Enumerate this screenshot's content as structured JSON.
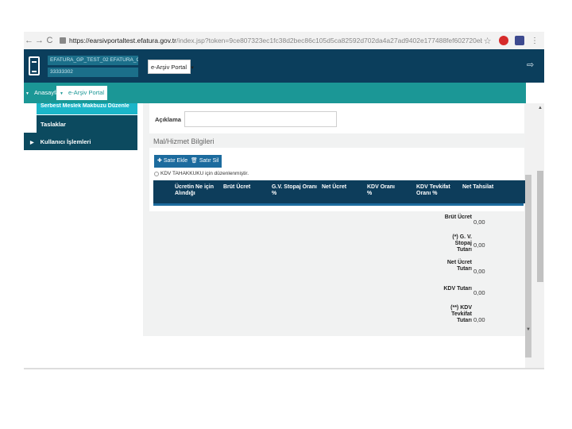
{
  "browser": {
    "url_host": "https://earsivportaltest.efatura.gov.tr",
    "url_rest": "/index.jsp?token=9ce807323ec1fc38d2bec86c105d5ca82592d702da4a27ad9402e177488fef602720ebaa0977e0b85964b32571f6282ee...",
    "back": "←",
    "forward": "→",
    "reload": "C",
    "star": "☆"
  },
  "header": {
    "user_line1": "EFATURA_GP_TEST_02 EFATURA_GP_TEST_02",
    "user_line2": "33333302",
    "portal_select": "e-Arşiv Portal",
    "logout_icon": "⇨"
  },
  "tabs": {
    "home": "Anasayfa",
    "portal": "e-Arşiv Portal"
  },
  "sidebar": {
    "items": [
      {
        "label": "Serbest Meslek Makbuzu Düzenle"
      },
      {
        "label": "Taslaklar"
      },
      {
        "label": "Kullanıcı İşlemleri"
      }
    ]
  },
  "form": {
    "description_label": "Açıklama",
    "description_value": "",
    "section_title": "Mal/Hizmet Bilgileri",
    "add_row": "Satır Ekle",
    "delete_row": "Satır Sil",
    "kdv_check_label": "KDV TAHAKKUKU için düzenlenmiştir."
  },
  "table": {
    "columns": [
      "Ücretin Ne için Alındığı",
      "Brüt Ücret",
      "G.V. Stopaj Oranı %",
      "Net Ücret",
      "KDV Oranı %",
      "KDV Tevkifat Oranı %",
      "Net Tahsilat"
    ]
  },
  "totals": [
    {
      "label": "Brüt Ücret",
      "value": "0,00"
    },
    {
      "label": "(*) G. V. Stopaj Tutarı",
      "value": "0,00"
    },
    {
      "label": "Net Ücret Tutarı",
      "value": "0,00"
    },
    {
      "label": "KDV Tutarı",
      "value": "0,00"
    },
    {
      "label": "(**) KDV Tevkifat Tutarı",
      "value": "0,00"
    }
  ],
  "colors": {
    "header_bg": "#0b3e5c",
    "tab_bar_bg": "#1b9796",
    "sidebar_bg": "#0c4a5f",
    "button_bg": "#1c6b9e"
  }
}
